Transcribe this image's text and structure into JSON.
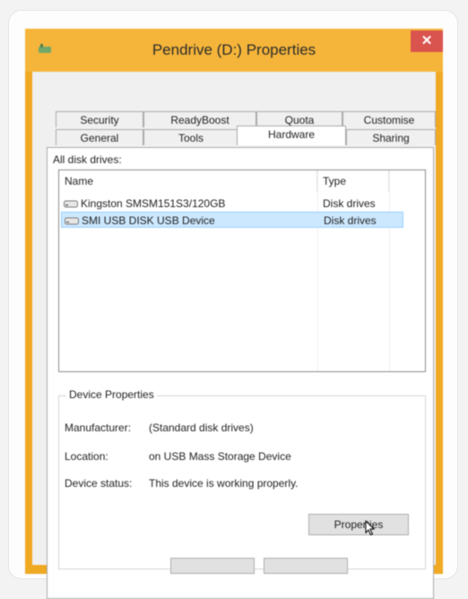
{
  "window": {
    "title": "Pendrive (D:) Properties",
    "close_glyph": "✕",
    "accent": "#f0a923",
    "close_color": "#d9534f",
    "app_icon": "drive-icon"
  },
  "tabs_back": [
    {
      "label": "Security"
    },
    {
      "label": "ReadyBoost"
    },
    {
      "label": "Quota"
    },
    {
      "label": "Customise"
    }
  ],
  "tabs_front": [
    {
      "label": "General"
    },
    {
      "label": "Tools"
    },
    {
      "label": "Hardware",
      "active": true
    },
    {
      "label": "Sharing"
    }
  ],
  "panel": {
    "all_drives_label": "All disk drives:",
    "columns": {
      "name": "Name",
      "type": "Type"
    },
    "rows": [
      {
        "name": "Kingston SMSM151S3/120GB",
        "type": "Disk drives",
        "selected": false
      },
      {
        "name": "SMI USB DISK USB Device",
        "type": "Disk drives",
        "selected": true
      }
    ],
    "device_properties": {
      "title": "Device Properties",
      "manufacturer_label": "Manufacturer:",
      "manufacturer_value": "(Standard disk drives)",
      "location_label": "Location:",
      "location_value": "on USB Mass Storage Device",
      "status_label": "Device status:",
      "status_value": "This device is working properly.",
      "properties_button": "Properties",
      "selection_color": "#cce8ff"
    }
  }
}
